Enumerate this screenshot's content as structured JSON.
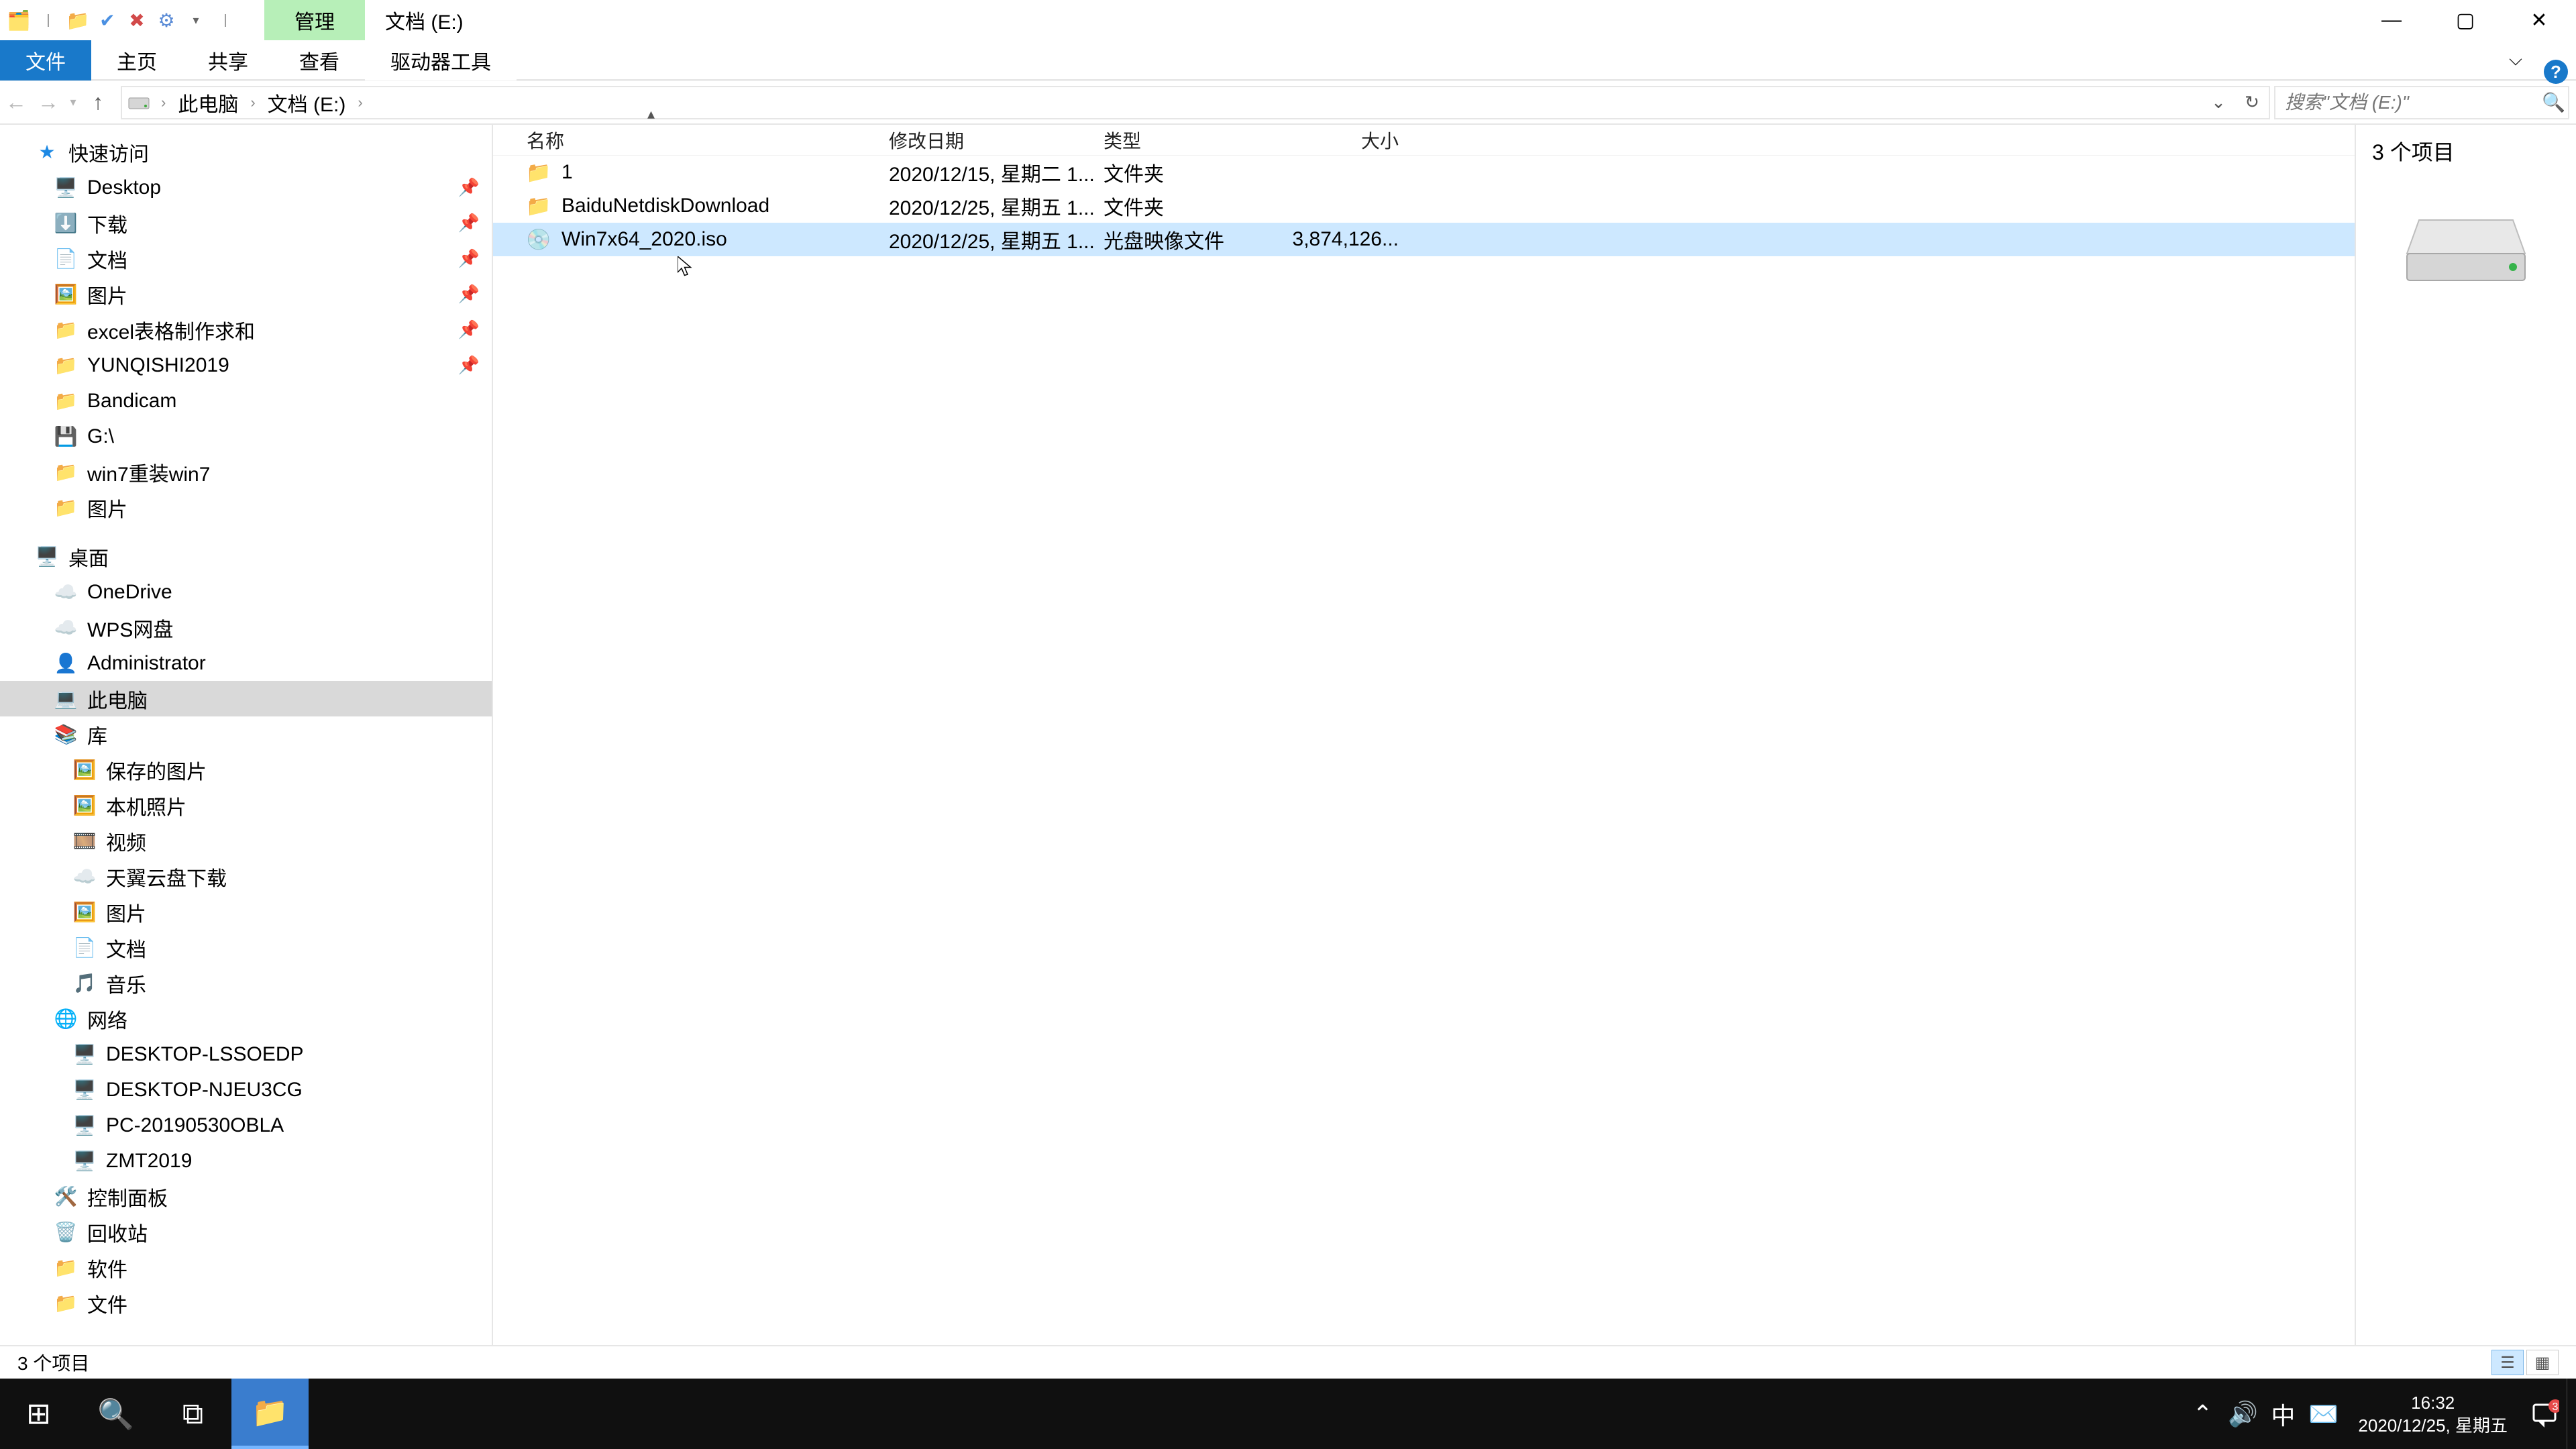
{
  "title": {
    "manage": "管理",
    "drive": "文档 (E:)"
  },
  "window_buttons": {
    "min": "—",
    "max": "▢",
    "close": "✕"
  },
  "ribbon": {
    "file": "文件",
    "home": "主页",
    "share": "共享",
    "view": "查看",
    "drive_tools": "驱动器工具"
  },
  "nav_buttons": {
    "back": "←",
    "forward": "→",
    "up": "↑"
  },
  "breadcrumb": {
    "root": "此电脑",
    "drive": "文档 (E:)"
  },
  "search": {
    "placeholder": "搜索\"文档 (E:)\""
  },
  "columns": {
    "name": "名称",
    "date": "修改日期",
    "type": "类型",
    "size": "大小"
  },
  "rows": [
    {
      "icon": "folder",
      "name": "1",
      "date": "2020/12/15, 星期二 1...",
      "type": "文件夹",
      "size": ""
    },
    {
      "icon": "folder",
      "name": "BaiduNetdiskDownload",
      "date": "2020/12/25, 星期五 1...",
      "type": "文件夹",
      "size": ""
    },
    {
      "icon": "iso",
      "name": "Win7x64_2020.iso",
      "date": "2020/12/25, 星期五 1...",
      "type": "光盘映像文件",
      "size": "3,874,126..."
    }
  ],
  "preview": {
    "count": "3 个项目"
  },
  "statusbar": {
    "count": "3 个项目"
  },
  "sidebar": {
    "quick": "快速访问",
    "quick_items": [
      "Desktop",
      "下载",
      "文档",
      "图片",
      "excel表格制作求和",
      "YUNQISHI2019",
      "Bandicam",
      "G:\\",
      "win7重装win7",
      "图片"
    ],
    "desktop": "桌面",
    "desktop_items": [
      "OneDrive",
      "WPS网盘",
      "Administrator",
      "此电脑",
      "库"
    ],
    "lib_items": [
      "保存的图片",
      "本机照片",
      "视频",
      "天翼云盘下载",
      "图片",
      "文档",
      "音乐"
    ],
    "network": "网络",
    "net_items": [
      "DESKTOP-LSSOEDP",
      "DESKTOP-NJEU3CG",
      "PC-20190530OBLA",
      "ZMT2019"
    ],
    "tail": [
      "控制面板",
      "回收站",
      "软件",
      "文件"
    ]
  },
  "tray": {
    "ime": "中",
    "time": "16:32",
    "date": "2020/12/25, 星期五",
    "notif_badge": "3"
  }
}
